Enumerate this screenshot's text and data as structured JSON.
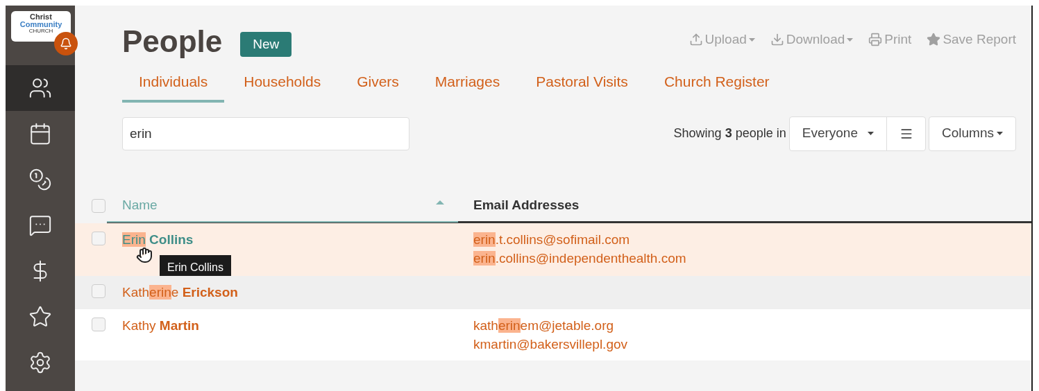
{
  "logo": {
    "line1": "Christ",
    "line2": "Community",
    "line3": "CHURCH"
  },
  "sidebar": {
    "items": [
      {
        "selected": true
      },
      {
        "selected": false
      },
      {
        "selected": false
      },
      {
        "selected": false
      },
      {
        "selected": false
      },
      {
        "selected": false
      },
      {
        "selected": false
      }
    ]
  },
  "page": {
    "title": "People",
    "new_button": "New"
  },
  "toolbar": [
    {
      "kind": "dropdown",
      "label": "Upload"
    },
    {
      "kind": "dropdown",
      "label": "Download"
    },
    {
      "kind": "button",
      "label": "Print"
    },
    {
      "kind": "button",
      "label": "Save Report"
    }
  ],
  "tabs": [
    {
      "label": "Individuals",
      "selected": true
    },
    {
      "label": "Households",
      "selected": false
    },
    {
      "label": "Givers",
      "selected": false
    },
    {
      "label": "Marriages",
      "selected": false
    },
    {
      "label": "Pastoral Visits",
      "selected": false
    },
    {
      "label": "Church Register",
      "selected": false
    }
  ],
  "search": {
    "value": "erin"
  },
  "summary": {
    "prefix": "Showing",
    "count": "3",
    "suffix": "people in"
  },
  "filter": {
    "value": "Everyone"
  },
  "columns_button": "Columns",
  "table": {
    "all_checked": false,
    "columns": [
      {
        "label": "Name",
        "sorted": true
      },
      {
        "label": "Email Addresses",
        "sorted": false
      }
    ],
    "rows": [
      {
        "hovered": true,
        "checked": false,
        "name": [
          {
            "text": "Erin",
            "hl": true,
            "bold": false
          },
          {
            "text": " Collins",
            "hl": false,
            "bold": true
          }
        ],
        "emails": [
          [
            {
              "text": "erin",
              "hl": true
            },
            {
              "text": ".t.collins@sofimail.com",
              "hl": false
            }
          ],
          [
            {
              "text": "erin",
              "hl": true
            },
            {
              "text": ".collins@independenthealth.com",
              "hl": false
            }
          ]
        ],
        "tooltip": "Erin Collins"
      },
      {
        "hovered": false,
        "checked": false,
        "name": [
          {
            "text": "Kath",
            "hl": false,
            "bold": false
          },
          {
            "text": "erin",
            "hl": true,
            "bold": false
          },
          {
            "text": "e",
            "hl": false,
            "bold": false
          },
          {
            "text": " Erickson",
            "hl": false,
            "bold": true
          }
        ],
        "emails": []
      },
      {
        "hovered": false,
        "checked": false,
        "name": [
          {
            "text": "Kathy",
            "hl": false,
            "bold": false
          },
          {
            "text": " Martin",
            "hl": false,
            "bold": true
          }
        ],
        "emails": [
          [
            {
              "text": "kath",
              "hl": false
            },
            {
              "text": "erin",
              "hl": true
            },
            {
              "text": "em@jetable.org",
              "hl": false
            }
          ],
          [
            {
              "text": "kmartin@bakersvillepl.gov",
              "hl": false
            }
          ]
        ]
      }
    ]
  }
}
